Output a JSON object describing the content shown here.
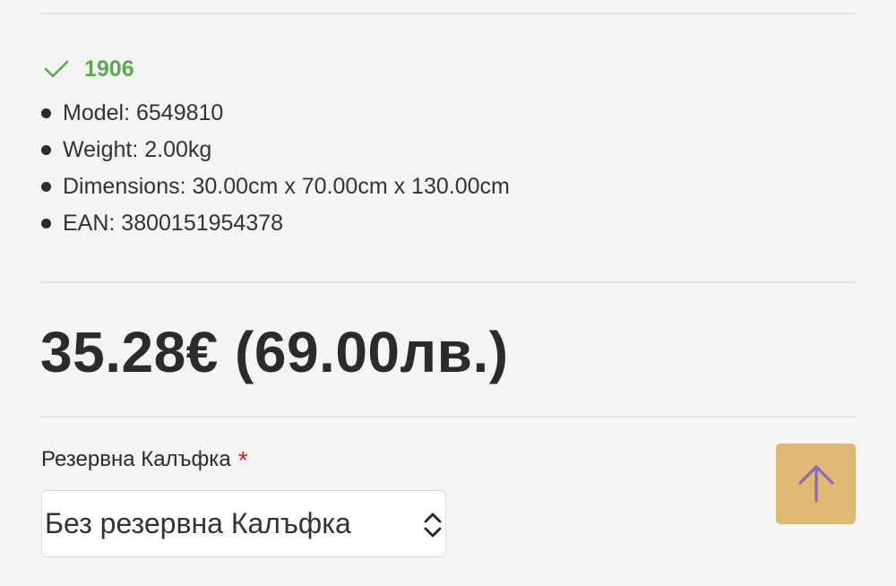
{
  "stock": {
    "label": "1906",
    "icon": "check-icon",
    "color": "#5aa84f"
  },
  "specs": [
    {
      "text": "Model: 6549810"
    },
    {
      "text": "Weight: 2.00kg"
    },
    {
      "text": "Dimensions: 30.00cm x 70.00cm x 130.00cm"
    },
    {
      "text": "EAN: 3800151954378"
    }
  ],
  "price": {
    "text": "35.28€ (69.00лв.)"
  },
  "option": {
    "label": "Резервна Калъфка",
    "required_mark": "*",
    "selected_value": "Без резервна Калъфка"
  },
  "back_to_top": {
    "icon": "arrow-up-icon",
    "background": "#dfb876",
    "icon_color": "#8b6bb0"
  }
}
